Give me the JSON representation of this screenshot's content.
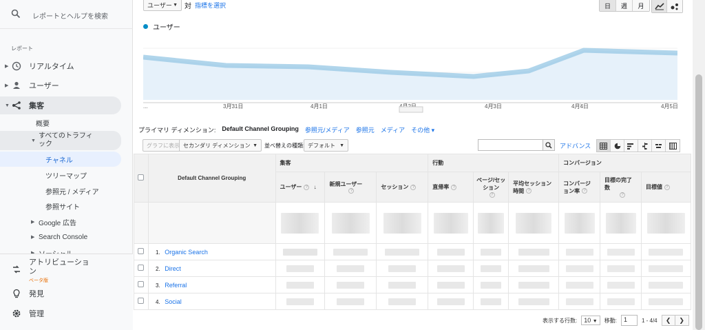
{
  "sidebar": {
    "search_label": "レポートとヘルプを検索",
    "section_label": "レポート",
    "items": [
      {
        "label": "リアルタイム",
        "icon": "clock-icon"
      },
      {
        "label": "ユーザー",
        "icon": "person-icon"
      },
      {
        "label": "集客",
        "icon": "acquisition-icon"
      }
    ],
    "acquisition_sub": {
      "overview": "概要",
      "all_traffic": "すべてのトラフィック",
      "channels": "チャネル",
      "treemap": "ツリーマップ",
      "source_medium": "参照元 / メディア",
      "referrals": "参照サイト",
      "google_ads": "Google 広告",
      "search_console": "Search Console",
      "social": "ソーシャル"
    },
    "bottom": {
      "attribution": "アトリビューション",
      "beta": "ベータ版",
      "discover": "発見",
      "admin": "管理"
    }
  },
  "toolbar": {
    "metric_select": "ユーザー",
    "vs_label": "対",
    "select_metric_link": "指標を選択",
    "period_buttons": [
      "日",
      "週",
      "月"
    ],
    "active_period": "日"
  },
  "chart": {
    "legend_label": "ユーザー",
    "series_color": "#058dc7",
    "x_tick_labels": [
      "...",
      "3月31日",
      "4月1日",
      "4月2日",
      "4月3日",
      "4月4日",
      "4月5日"
    ]
  },
  "dimensions": {
    "primary_label": "プライマリ ディメンション:",
    "current": "Default Channel Grouping",
    "options": [
      "参照元/メディア",
      "参照元",
      "メディア",
      "その他 ▾"
    ]
  },
  "table_tools": {
    "plot_rows": "グラフに表示",
    "secondary_dimension": "セカンダリ ディメンション",
    "sort_type_label": "並べ替えの種類:",
    "sort_type_value": "デフォルト",
    "advanced": "アドバンス"
  },
  "table": {
    "first_header": "Default Channel Grouping",
    "groups": [
      "集客",
      "行動",
      "コンバージョン"
    ],
    "columns": [
      "ユーザー",
      "新規ユーザー",
      "セッション",
      "直帰率",
      "ページ/セッション",
      "平均セッション時間",
      "コンバージョン率",
      "目標の完了数",
      "目標値"
    ],
    "rows": [
      {
        "num": "1.",
        "name": "Organic Search"
      },
      {
        "num": "2.",
        "name": "Direct"
      },
      {
        "num": "3.",
        "name": "Referral"
      },
      {
        "num": "4.",
        "name": "Social"
      }
    ]
  },
  "pager": {
    "rows_label": "表示する行数:",
    "rows_value": "10",
    "goto_label": "移動:",
    "goto_value": "1",
    "range": "1 - 4/4"
  }
}
